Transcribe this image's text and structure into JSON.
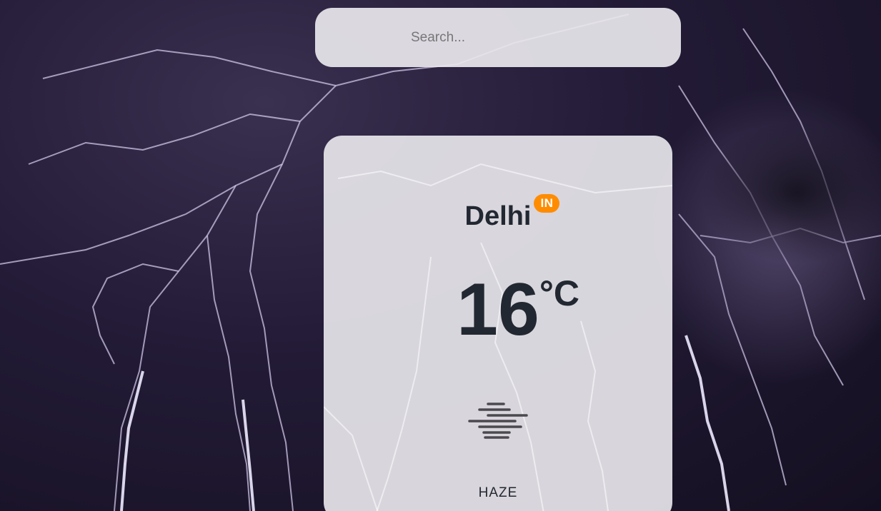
{
  "search": {
    "placeholder": "Search..."
  },
  "weather": {
    "city": "Delhi",
    "country": "IN",
    "temperature": "16",
    "unit": "°C",
    "description": "HAZE",
    "icon": "haze-icon"
  },
  "colors": {
    "accent": "#ff8c00",
    "text": "#222831",
    "card": "#e8e6ec"
  }
}
